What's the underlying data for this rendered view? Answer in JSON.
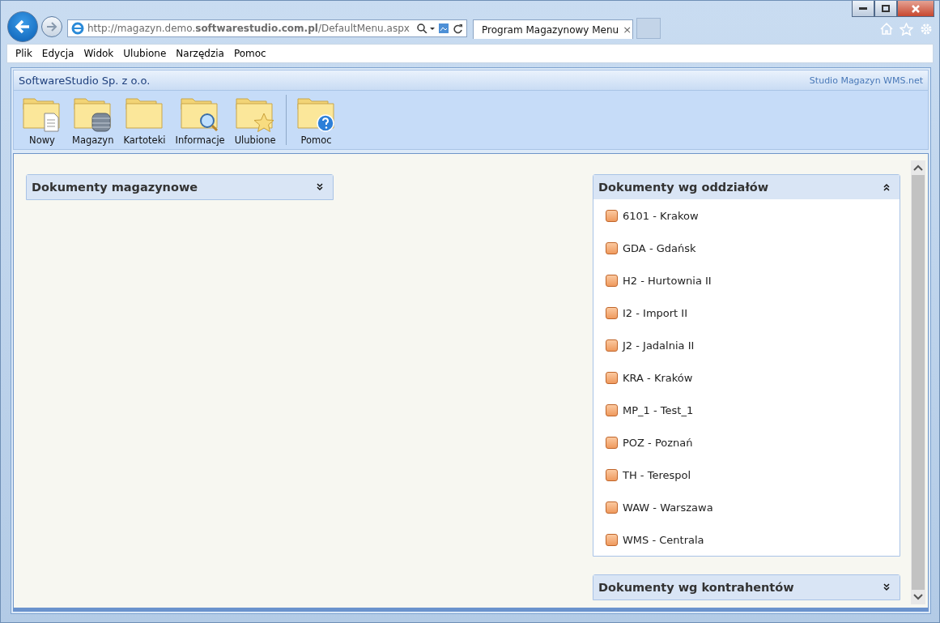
{
  "browser": {
    "address": "http://magazyn.demo.**softwarestudio.com.pl**/DefaultMenu.aspx",
    "tab": {
      "title": "Program Magazynowy Menu",
      "close": "×",
      "selected": true
    },
    "menu": [
      "Plik",
      "Edycja",
      "Widok",
      "Ulubione",
      "Narzędzia",
      "Pomoc"
    ]
  },
  "app": {
    "company": "SoftwareStudio Sp. z o.o.",
    "product": "Studio Magazyn WMS.net",
    "toolbar": [
      {
        "items": [
          {
            "kind": "document",
            "label": "Nowy"
          },
          {
            "kind": "database",
            "label": "Magazyn"
          },
          {
            "kind": "plain",
            "label": "Kartoteki"
          },
          {
            "kind": "magnifier",
            "label": "Informacje"
          },
          {
            "kind": "star",
            "label": "Ulubione"
          }
        ]
      },
      {
        "items": [
          {
            "kind": "help",
            "label": "Pomoc"
          }
        ]
      }
    ],
    "columns": [
      [
        {
          "title": "Dokumenty magazynowe",
          "expanded": false
        }
      ],
      [
        {
          "title": "Dokumenty wg oddziałów",
          "expanded": true,
          "items": [
            "6101 - Krakow",
            "GDA - Gdańsk",
            "H2 - Hurtownia II",
            "I2 - Import II",
            "J2 - Jadalnia II",
            "KRA - Kraków",
            "MP_1 - Test_1",
            "POZ - Poznań",
            "TH - Terespol",
            "WAW - Warszawa",
            "WMS - Centrala"
          ]
        },
        {
          "title": "Dokumenty wg kontrahentów",
          "expanded": false
        }
      ]
    ]
  }
}
